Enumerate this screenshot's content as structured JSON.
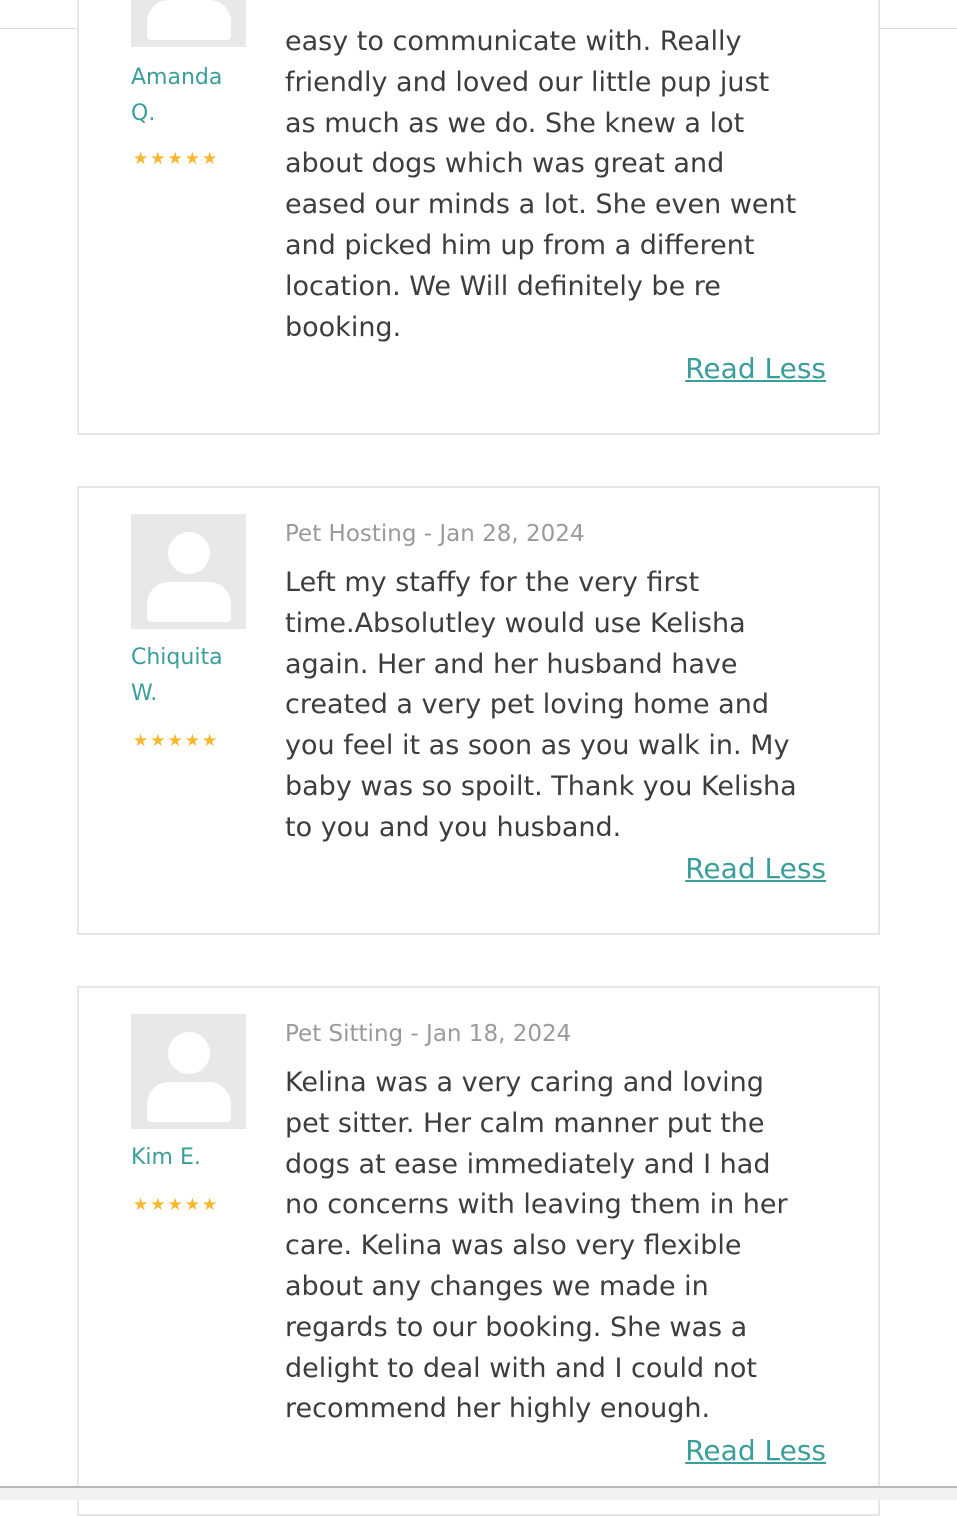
{
  "reviews": [
    {
      "name": "Amanda\nQ.",
      "stars": "★★★★★",
      "rating": 5,
      "service": "",
      "text": "easy to communicate with. Really\nfriendly and loved our little pup just\nas much as we do. She knew a lot\nabout dogs which was great and\neased our minds a lot. She even went\nand picked him up from a different\nlocation. We Will definitely be re\nbooking.",
      "read_less": "Read Less"
    },
    {
      "name": "Chiquita\nW.",
      "stars": "★★★★★",
      "rating": 5,
      "service": "Pet Hosting - Jan 28, 2024",
      "text": "Left my staffy for the very first\ntime.Absolutley would use Kelisha\nagain. Her and her husband have\ncreated a very pet loving home and\nyou feel it as soon as you walk in. My\nbaby was so spoilt. Thank you Kelisha\nto you and you husband.",
      "read_less": "Read Less"
    },
    {
      "name": "Kim E.",
      "stars": "★★★★★",
      "rating": 5,
      "service": "Pet Sitting - Jan 18, 2024",
      "text": "Kelina was a very caring and loving\npet sitter. Her calm manner put the\ndogs at ease immediately and I had\nno concerns with leaving them in her\ncare. Kelina was also very flexible\nabout any changes we made in\nregards to our booking. She was a\ndelight to deal with and I could not\nrecommend her highly enough.",
      "read_less": "Read Less"
    }
  ],
  "colors": {
    "accent": "#3a9e9a",
    "star": "#f5b82e",
    "text": "#3d3d3d",
    "muted": "#9a9a9a",
    "border": "#e6e6e6"
  }
}
